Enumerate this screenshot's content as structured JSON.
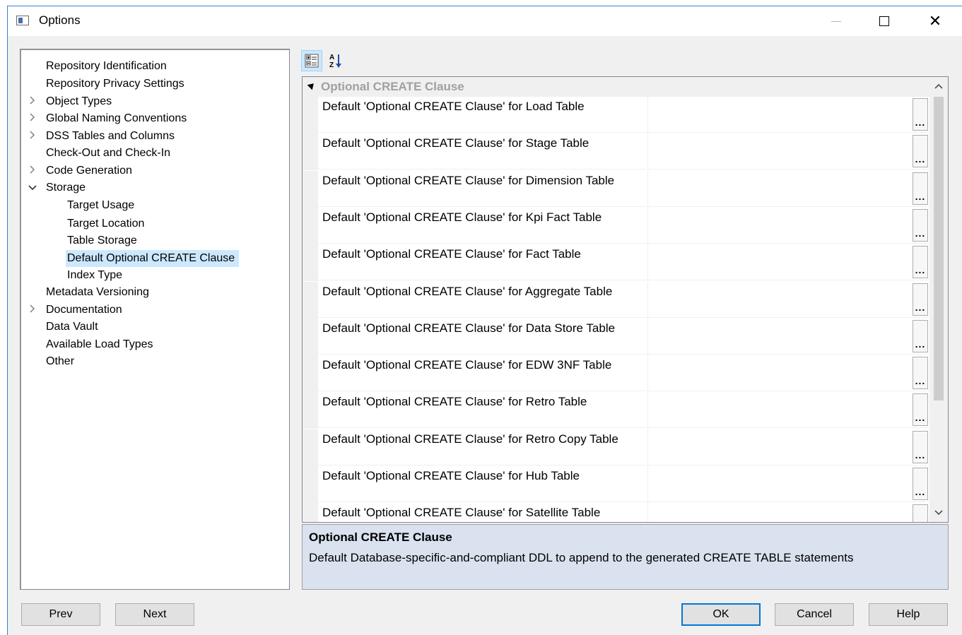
{
  "window": {
    "title": "Options",
    "close_glyph": "✕"
  },
  "tree": {
    "items": [
      {
        "label": "Repository Identification",
        "level": 0,
        "expander": "none",
        "selected": false
      },
      {
        "label": "Repository Privacy Settings",
        "level": 0,
        "expander": "none",
        "selected": false
      },
      {
        "label": "Object Types",
        "level": 0,
        "expander": "collapsed",
        "selected": false
      },
      {
        "label": "Global Naming Conventions",
        "level": 0,
        "expander": "collapsed",
        "selected": false
      },
      {
        "label": "DSS Tables and Columns",
        "level": 0,
        "expander": "collapsed",
        "selected": false
      },
      {
        "label": "Check-Out and Check-In",
        "level": 0,
        "expander": "none",
        "selected": false
      },
      {
        "label": "Code Generation",
        "level": 0,
        "expander": "collapsed",
        "selected": false
      },
      {
        "label": "Storage",
        "level": 0,
        "expander": "expanded",
        "selected": false
      },
      {
        "label": "Target Usage",
        "level": 1,
        "expander": "none",
        "selected": false
      },
      {
        "label": "Target Location",
        "level": 1,
        "expander": "none",
        "selected": false
      },
      {
        "label": "Table Storage",
        "level": 1,
        "expander": "none",
        "selected": false
      },
      {
        "label": "Default Optional CREATE Clause",
        "level": 1,
        "expander": "none",
        "selected": true
      },
      {
        "label": "Index Type",
        "level": 1,
        "expander": "none",
        "selected": false
      },
      {
        "label": "Metadata Versioning",
        "level": 0,
        "expander": "none",
        "selected": false
      },
      {
        "label": "Documentation",
        "level": 0,
        "expander": "collapsed",
        "selected": false
      },
      {
        "label": "Data Vault",
        "level": 0,
        "expander": "none",
        "selected": false
      },
      {
        "label": "Available Load Types",
        "level": 0,
        "expander": "none",
        "selected": false
      },
      {
        "label": "Other",
        "level": 0,
        "expander": "none",
        "selected": false
      }
    ]
  },
  "property_grid": {
    "toolbar": {
      "categorized_icon": "categorized-view-icon",
      "alphabetical_icon": "alphabetical-sort-icon"
    },
    "category": {
      "label": "Optional CREATE Clause"
    },
    "ellipsis_label": "...",
    "rows": [
      {
        "name": "Default 'Optional CREATE Clause' for Load Table",
        "value": ""
      },
      {
        "name": "Default 'Optional CREATE Clause' for Stage Table",
        "value": ""
      },
      {
        "name": "Default 'Optional CREATE Clause' for Dimension Table",
        "value": ""
      },
      {
        "name": "Default 'Optional CREATE Clause' for Kpi Fact Table",
        "value": ""
      },
      {
        "name": "Default 'Optional CREATE Clause' for Fact Table",
        "value": ""
      },
      {
        "name": "Default 'Optional CREATE Clause' for Aggregate Table",
        "value": ""
      },
      {
        "name": "Default 'Optional CREATE Clause' for Data Store Table",
        "value": ""
      },
      {
        "name": "Default 'Optional CREATE Clause' for EDW 3NF Table",
        "value": ""
      },
      {
        "name": "Default 'Optional CREATE Clause' for Retro Table",
        "value": ""
      },
      {
        "name": "Default 'Optional CREATE Clause' for Retro Copy Table",
        "value": ""
      },
      {
        "name": "Default 'Optional CREATE Clause' for Hub Table",
        "value": ""
      },
      {
        "name": "Default 'Optional CREATE Clause' for Satellite Table",
        "value": ""
      }
    ]
  },
  "help": {
    "title": "Optional CREATE Clause",
    "description": "Default Database-specific-and-compliant DDL to append to the generated CREATE TABLE statements"
  },
  "buttons": {
    "prev": "Prev",
    "next": "Next",
    "ok": "OK",
    "cancel": "Cancel",
    "help": "Help"
  }
}
